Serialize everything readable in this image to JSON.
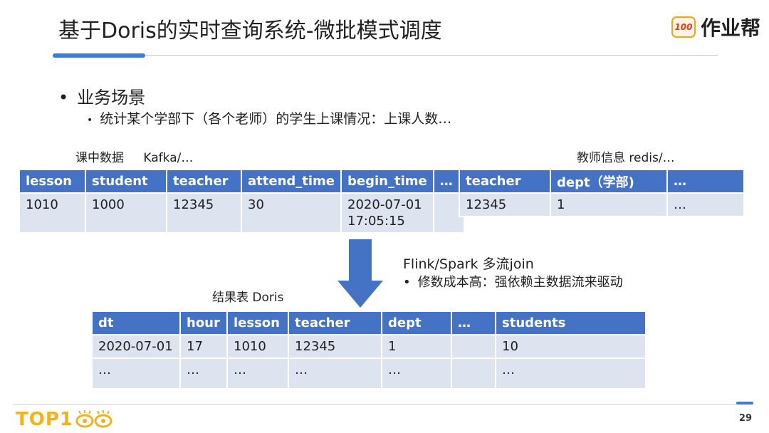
{
  "title": "基于Doris的实时查询系统-微批模式调度",
  "logo": {
    "badge": "100",
    "name": "作业帮"
  },
  "bullets": {
    "main": "业务场景",
    "sub": "统计某个学部下（各个老师）的学生上课情况：上课人数…"
  },
  "kafka_table": {
    "caption_name": "课中数据",
    "caption_source": "Kafka/…",
    "headers": [
      "lesson",
      "student",
      "teacher",
      "attend_time",
      "begin_time",
      "…"
    ],
    "row": [
      "1010",
      "1000",
      "12345",
      "30",
      "2020-07-01",
      "17:05:15",
      ""
    ]
  },
  "redis_table": {
    "caption": "教师信息 redis/…",
    "headers": [
      "teacher",
      "dept（学部)",
      "…"
    ],
    "row": [
      "12345",
      "1",
      "…"
    ]
  },
  "notes": {
    "engine": "Flink/Spark 多流join",
    "cost": "修数成本高：强依赖主数据流来驱动"
  },
  "result_table": {
    "caption": "结果表 Doris",
    "headers": [
      "dt",
      "hour",
      "lesson",
      "teacher",
      "dept",
      "…",
      "students"
    ],
    "rows": [
      [
        "2020-07-01",
        "17",
        "1010",
        "12345",
        "1",
        "",
        "10"
      ],
      [
        "…",
        "…",
        "…",
        "…",
        "…",
        "",
        "…"
      ]
    ]
  },
  "footer": {
    "logo_text": "TOP1",
    "page_number": "29"
  },
  "colors": {
    "header_blue": "#4472c4",
    "cell_bg": "#dde3ef",
    "arrow_blue": "#4472c4",
    "accent": "#3b7dd8",
    "footer_gold": "#f2b21b"
  }
}
